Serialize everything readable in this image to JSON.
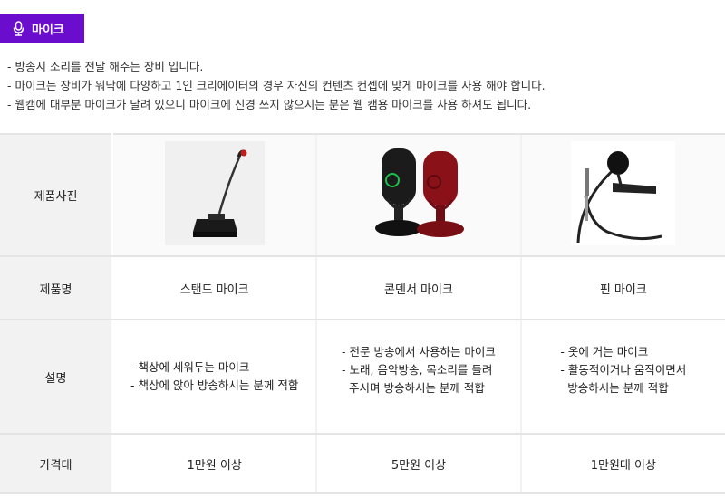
{
  "badge": {
    "label": "마이크",
    "icon": "microphone-icon",
    "color": "#6a0dcc"
  },
  "intro": [
    "- 방송시 소리를 전달 해주는 장비 입니다.",
    "- 마이크는 장비가 워낙에 다양하고 1인 크리에이터의 경우 자신의 컨텐츠 컨셉에 맞게 마이크를 사용 해야 합니다.",
    "- 웹캠에 대부분 마이크가 달려 있으니 마이크에 신경 쓰지 않으시는 분은 웹 캠용 마이크를 사용 하셔도 됩니다."
  ],
  "table": {
    "row_headers": {
      "photo": "제품사진",
      "name": "제품명",
      "desc": "설명",
      "price": "가격대"
    },
    "products": [
      {
        "name": "스탠드 마이크",
        "image": "stand-microphone",
        "desc": [
          "- 책상에 세워두는 마이크",
          "- 책상에 앉아 방송하시는 분께 적합"
        ],
        "price": "1만원 이상"
      },
      {
        "name": "콘덴서 마이크",
        "image": "condenser-microphones",
        "desc": [
          "- 전문 방송에서 사용하는  마이크",
          "- 노래, 음악방송, 목소리를 들려",
          "  주시며 방송하시는 분께 적합"
        ],
        "price": "5만원 이상"
      },
      {
        "name": "핀 마이크",
        "image": "pin-microphone",
        "desc": [
          "- 옷에 거는 마이크",
          "- 활동적이거나 움직이면서",
          "  방송하시는 분께 적합"
        ],
        "price": "1만원대 이상"
      }
    ]
  }
}
